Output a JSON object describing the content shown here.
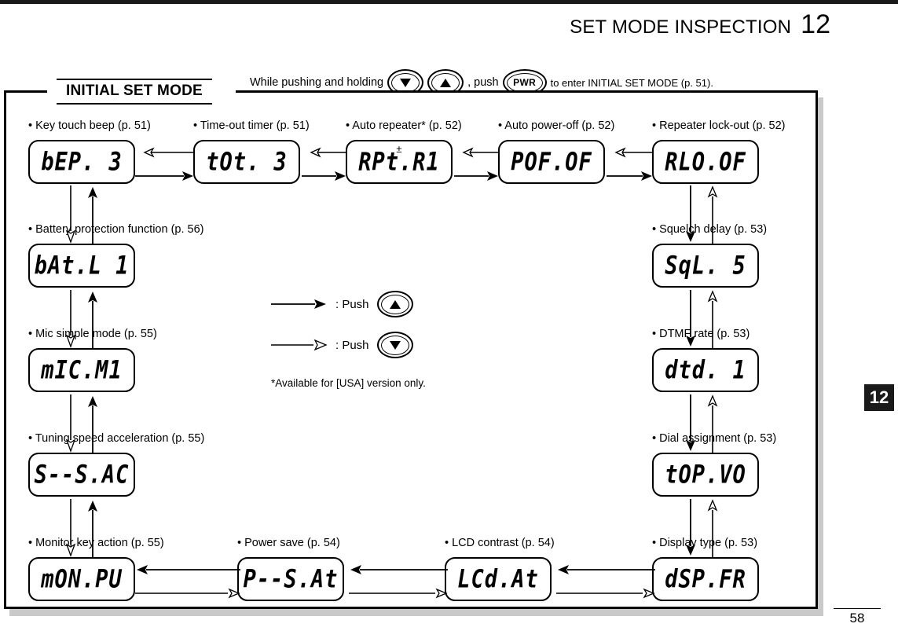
{
  "header": {
    "title": "SET MODE INSPECTION",
    "chapter": "12"
  },
  "instruction": {
    "prefix": "While pushing and holding",
    "middle": ", push",
    "suffix": "to enter INITIAL SET MODE (p. 51).",
    "key_down": "down-arrow",
    "key_up": "up-arrow",
    "key_pwr": "PWR"
  },
  "diagram": {
    "title": "INITIAL SET MODE",
    "nodes": [
      {
        "caption": "• Key touch beep (p. 51)",
        "display": "bEP. 3",
        "badge": ""
      },
      {
        "caption": "• Time-out timer (p. 51)",
        "display": "tOt. 3",
        "badge": ""
      },
      {
        "caption": "• Auto repeater* (p. 52)",
        "display": "RPt.R1",
        "badge": "±"
      },
      {
        "caption": "• Auto power-off (p. 52)",
        "display": "POF.OF",
        "badge": ""
      },
      {
        "caption": "• Repeater lock-out (p. 52)",
        "display": "RLO.OF",
        "badge": ""
      },
      {
        "caption": "• Squelch delay (p. 53)",
        "display": "SqL. 5",
        "badge": ""
      },
      {
        "caption": "• DTMF rate (p. 53)",
        "display": "dtd. 1",
        "badge": ""
      },
      {
        "caption": "• Dial assignment (p. 53)",
        "display": "tOP.VO",
        "badge": ""
      },
      {
        "caption": "• Display type (p. 53)",
        "display": "dSP.FR",
        "badge": ""
      },
      {
        "caption": "• LCD contrast (p. 54)",
        "display": "LCd.At",
        "badge": ""
      },
      {
        "caption": "• Power save (p. 54)",
        "display": "P--S.At",
        "badge": ""
      },
      {
        "caption": "• Monitor key action (p. 55)",
        "display": "mON.PU",
        "badge": ""
      },
      {
        "caption": "• Tuning speed acceleration (p. 55)",
        "display": "S--S.AC",
        "badge": ""
      },
      {
        "caption": "• Mic simple mode (p. 55)",
        "display": "mIC.M1",
        "badge": ""
      },
      {
        "caption": "• Battery protection function (p. 56)",
        "display": "bAt.L 1",
        "badge": ""
      }
    ],
    "legend": {
      "solid_label": ": Push",
      "hollow_label": ": Push",
      "solid_key": "up-arrow",
      "hollow_key": "down-arrow",
      "note": "*Available for [USA] version only."
    }
  },
  "footer": {
    "page_number": "58"
  }
}
